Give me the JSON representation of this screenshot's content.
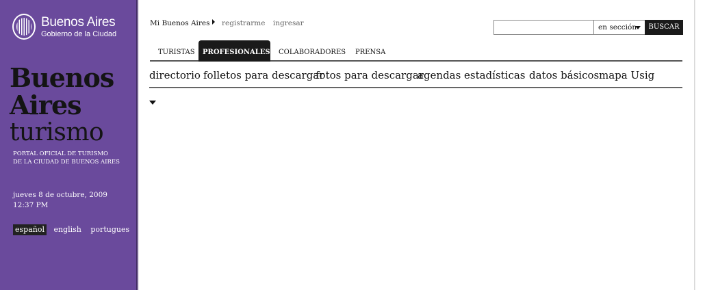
{
  "sidebar": {
    "logo": {
      "title": "Buenos Aires",
      "subtitle": "Gobierno de la Ciudad"
    },
    "brand": {
      "line1": "Buenos",
      "line2": "Aires",
      "line3": "turismo"
    },
    "tagline": {
      "line1": "PORTAL OFICIAL DE TURISMO",
      "line2": "DE LA CIUDAD DE BUENOS AIRES"
    },
    "datetime": {
      "date": "jueves 8 de octubre, 2009",
      "time": "12:37 PM"
    },
    "languages": [
      {
        "label": "español",
        "active": true
      },
      {
        "label": "english",
        "active": false
      },
      {
        "label": "portugues",
        "active": false
      }
    ],
    "color": "#6a4a9c"
  },
  "header": {
    "user_link": "Mi Buenos Aires",
    "register": "registrarme",
    "login": "ingresar"
  },
  "search": {
    "value": "",
    "scope": "en sección",
    "button": "BUSCAR"
  },
  "tabs": [
    {
      "label": "TURISTAS",
      "active": false
    },
    {
      "label": "PROFESIONALES",
      "active": true
    },
    {
      "label": "COLABORADORES",
      "active": false
    },
    {
      "label": "PRENSA",
      "active": false
    }
  ],
  "subnav": [
    {
      "label": "directorio"
    },
    {
      "label": "folletos para descargar"
    },
    {
      "label": "fotos para descargar"
    },
    {
      "label": "agendas"
    },
    {
      "label": "estadísticas"
    },
    {
      "label": "datos básicos"
    },
    {
      "label": "mapa Usig"
    }
  ]
}
